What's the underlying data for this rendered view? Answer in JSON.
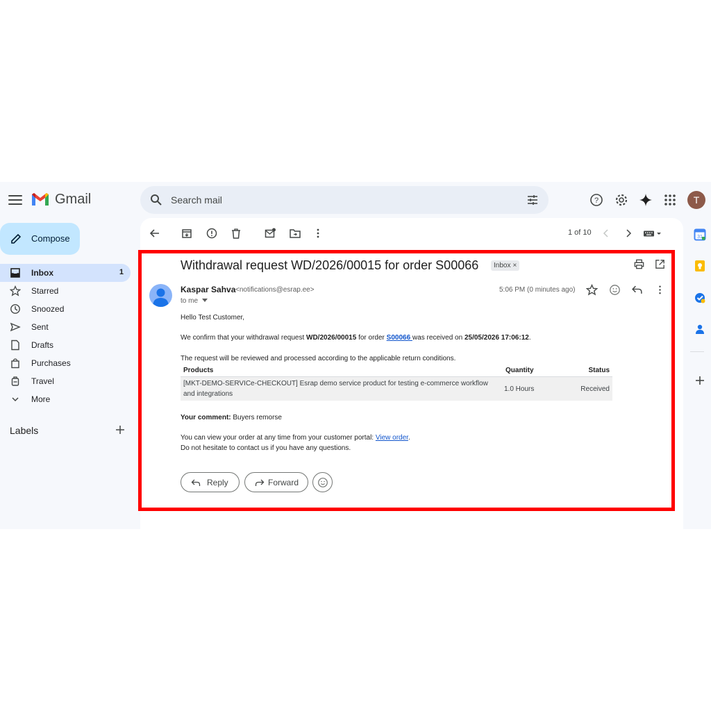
{
  "header": {
    "app_name": "Gmail",
    "search_placeholder": "Search mail",
    "avatar_letter": "T"
  },
  "sidebar": {
    "compose_label": "Compose",
    "items": [
      {
        "label": "Inbox",
        "count": "1",
        "icon": "inbox-icon"
      },
      {
        "label": "Starred",
        "icon": "star-icon"
      },
      {
        "label": "Snoozed",
        "icon": "clock-icon"
      },
      {
        "label": "Sent",
        "icon": "send-icon"
      },
      {
        "label": "Drafts",
        "icon": "draft-icon"
      },
      {
        "label": "Purchases",
        "icon": "bag-icon"
      },
      {
        "label": "Travel",
        "icon": "luggage-icon"
      },
      {
        "label": "More",
        "icon": "chevron-down-icon"
      }
    ],
    "labels_title": "Labels"
  },
  "toolbar": {
    "pager": "1 of 10"
  },
  "email": {
    "subject": "Withdrawal request WD/2026/00015 for order S00066",
    "tag": "Inbox",
    "tag_close": "×",
    "sender_name": "Kaspar Sahva",
    "sender_email": "<notifications@esrap.ee>",
    "to": "to me",
    "time": "5:06 PM (0 minutes ago)",
    "greeting": "Hello Test Customer,",
    "confirm_prefix": "We confirm that your withdrawal request ",
    "request_id": "WD/2026/00015",
    "confirm_mid": " for order ",
    "order_link": "S00066 ",
    "confirm_mid2": "was received on ",
    "received_at": "25/05/2026 17:06:12",
    "confirm_end": ".",
    "review_note": "The request will be reviewed and processed according to the applicable return conditions.",
    "table_headers": {
      "products": "Products",
      "quantity": "Quantity",
      "status": "Status"
    },
    "table_rows": [
      {
        "product_line1": "[MKT-DEMO-SERVICe-CHECKOUT] Esrap demo service product for testing e-commerce workflow",
        "product_line2": "and integrations",
        "quantity": "1.0 Hours",
        "status": "Received"
      }
    ],
    "comment_label": "Your comment:",
    "comment_text": " Buyers remorse",
    "portal_text": "You can view your order at any time from your customer portal: ",
    "portal_link": "View order",
    "portal_end": ".",
    "contact_text": "Do not hesitate to contact us if you have any questions.",
    "reply_label": "Reply",
    "forward_label": "Forward"
  },
  "colors": {
    "highlight_border": "#ff0000",
    "compose_bg": "#c2e7ff",
    "active_nav": "#d3e3fd",
    "link": "#1155cc"
  }
}
